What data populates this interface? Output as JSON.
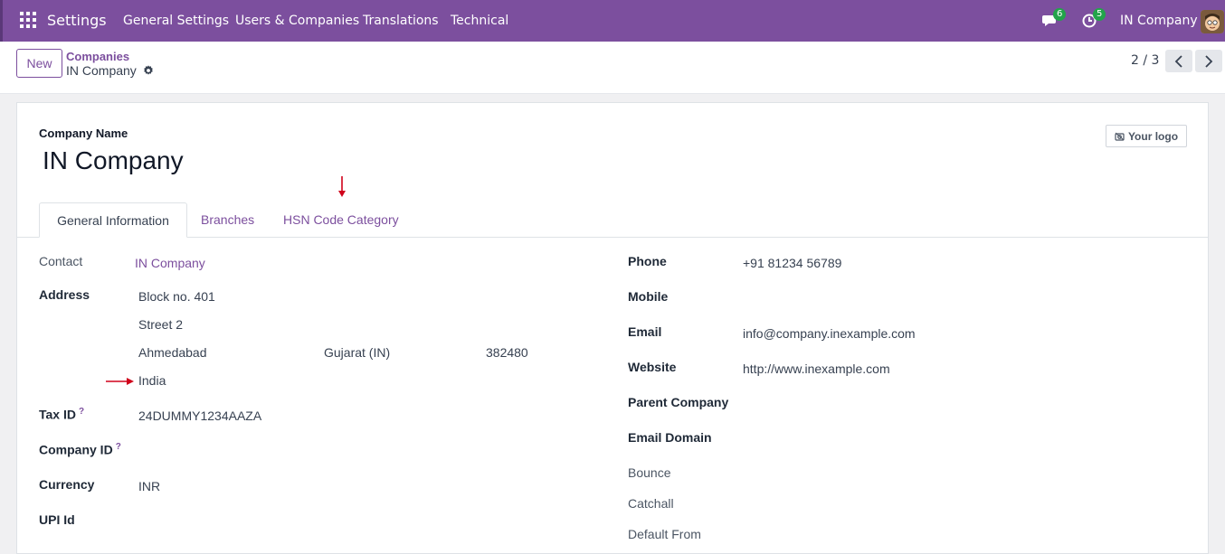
{
  "topbar": {
    "app": "Settings",
    "menu": [
      "General Settings",
      "Users & Companies",
      "Translations",
      "Technical"
    ],
    "messages_count": "6",
    "activities_count": "5",
    "company": "IN Company"
  },
  "control": {
    "new_label": "New",
    "breadcrumb_parent": "Companies",
    "breadcrumb_current": "IN Company",
    "pager": "2 / 3"
  },
  "form": {
    "name_caption": "Company Name",
    "name": "IN Company",
    "logo_label": "Your logo",
    "tabs": [
      "General Information",
      "Branches",
      "HSN Code Category"
    ]
  },
  "left": {
    "contact_label": "Contact",
    "contact_value": "IN Company",
    "address_label": "Address",
    "street": "Block no. 401",
    "street2": "Street 2",
    "city": "Ahmedabad",
    "state": "Gujarat (IN)",
    "zip": "382480",
    "country": "India",
    "tax_label": "Tax ID",
    "tax_value": "24DUMMY1234AAZA",
    "company_id_label": "Company ID",
    "currency_label": "Currency",
    "currency_value": "INR",
    "upi_label": "UPI Id",
    "help_mark": "?"
  },
  "right": {
    "phone_label": "Phone",
    "phone_value": "+91 81234 56789",
    "mobile_label": "Mobile",
    "email_label": "Email",
    "email_value": "info@company.inexample.com",
    "website_label": "Website",
    "website_value": "http://www.inexample.com",
    "parent_label": "Parent Company",
    "domain_label": "Email Domain",
    "bounce_label": "Bounce",
    "catchall_label": "Catchall",
    "default_from_label": "Default From"
  },
  "colors": {
    "brand": "#7c4f9e",
    "badge": "#22a44a",
    "annotation": "#d0021b"
  }
}
